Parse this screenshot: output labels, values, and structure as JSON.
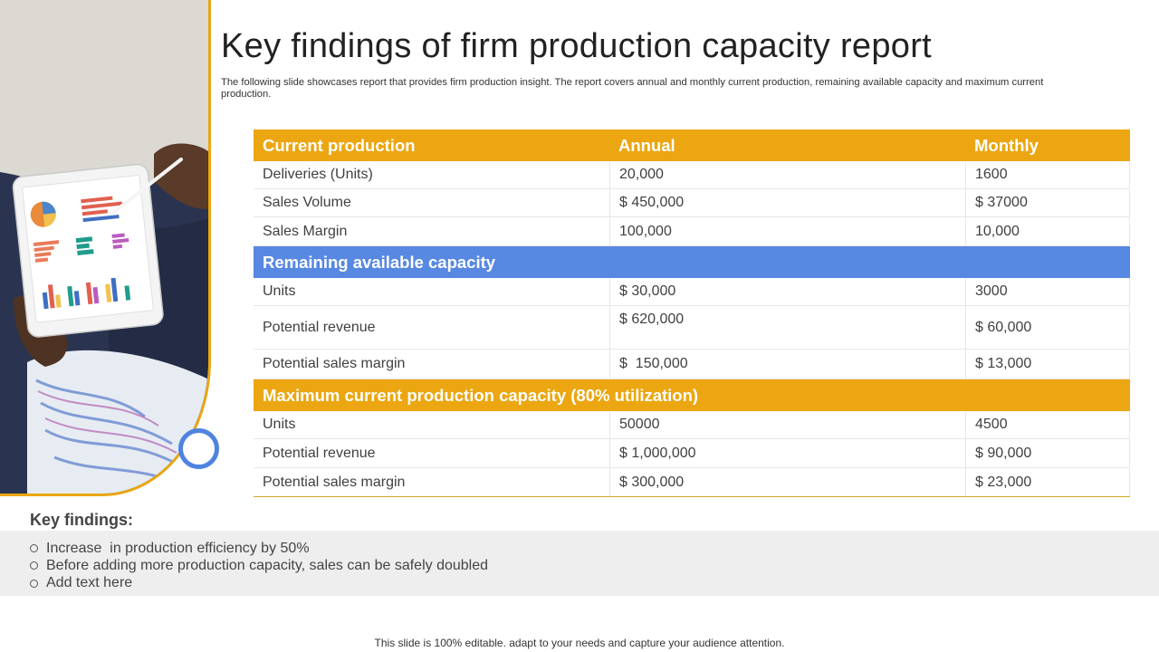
{
  "title": "Key findings of firm production capacity report",
  "subtitle": "The following slide showcases report that provides firm production insight. The report covers annual and monthly current production, remaining available capacity and maximum current production.",
  "colors": {
    "accent_yellow": "#eba611",
    "accent_blue": "#5788e2"
  },
  "table": {
    "header": {
      "col1": "Current production",
      "col2": "Annual",
      "col3": "Monthly"
    },
    "current_rows": [
      {
        "label": "Deliveries (Units)",
        "annual": "20,000",
        "monthly": "1600"
      },
      {
        "label": "Sales Volume",
        "annual": "$ 450,000",
        "monthly": "$ 37000"
      },
      {
        "label": "Sales Margin",
        "annual": "100,000",
        "monthly": "10,000"
      }
    ],
    "section2_title": "Remaining available capacity",
    "remaining_rows": [
      {
        "label": "Units",
        "annual": "$ 30,000",
        "monthly": "3000"
      },
      {
        "label": "Potential revenue",
        "annual": "$ 620,000",
        "monthly": "$ 60,000"
      },
      {
        "label": "Potential sales margin",
        "annual": "$  150,000",
        "monthly": "$ 13,000"
      }
    ],
    "section3_title": "Maximum current production capacity (80% utilization)",
    "maximum_rows": [
      {
        "label": "Units",
        "annual": "50000",
        "monthly": "4500"
      },
      {
        "label": "Potential revenue",
        "annual": "$ 1,000,000",
        "monthly": "$ 90,000"
      },
      {
        "label": "Potential sales margin",
        "annual": "$ 300,000",
        "monthly": "$ 23,000"
      }
    ]
  },
  "key_findings": {
    "title": "Key findings:",
    "items": [
      "Increase  in production efficiency by 50%",
      "Before adding more production capacity, sales can be safely doubled",
      "Add text here"
    ]
  },
  "footer": "This slide is 100% editable. adapt to your needs and capture your audience attention."
}
